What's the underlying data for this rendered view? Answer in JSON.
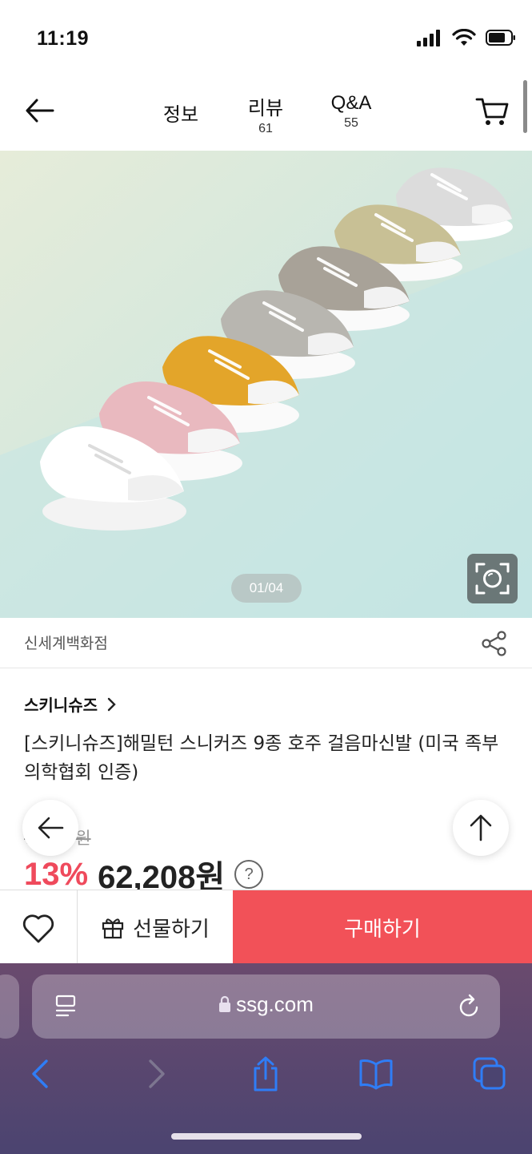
{
  "status_bar": {
    "time": "11:19"
  },
  "header": {
    "tabs": [
      {
        "label": "정보",
        "count": ""
      },
      {
        "label": "리뷰",
        "count": "61"
      },
      {
        "label": "Q&A",
        "count": "55"
      }
    ]
  },
  "gallery": {
    "counter": "01/04"
  },
  "seller": {
    "name": "신세계백화점"
  },
  "product": {
    "brand": "스키니슈즈",
    "title": "[스키니슈즈]해밀턴 스니커즈 9종 호주 걸음마신발 (미국 족부의학협회 인증)",
    "original_price": "72,000원",
    "discount": "13%",
    "price": "62,208원",
    "help": "?"
  },
  "buy_bar": {
    "gift_label": "선물하기",
    "buy_label": "구매하기"
  },
  "browser": {
    "url": "ssg.com"
  },
  "colors": {
    "accent": "#f25158",
    "discount": "#ef4a5c",
    "safari_tint": "#2f7df6"
  },
  "shoe_colors": [
    "white",
    "rose gold",
    "mustard",
    "grey",
    "taupe",
    "gold",
    "silver"
  ]
}
